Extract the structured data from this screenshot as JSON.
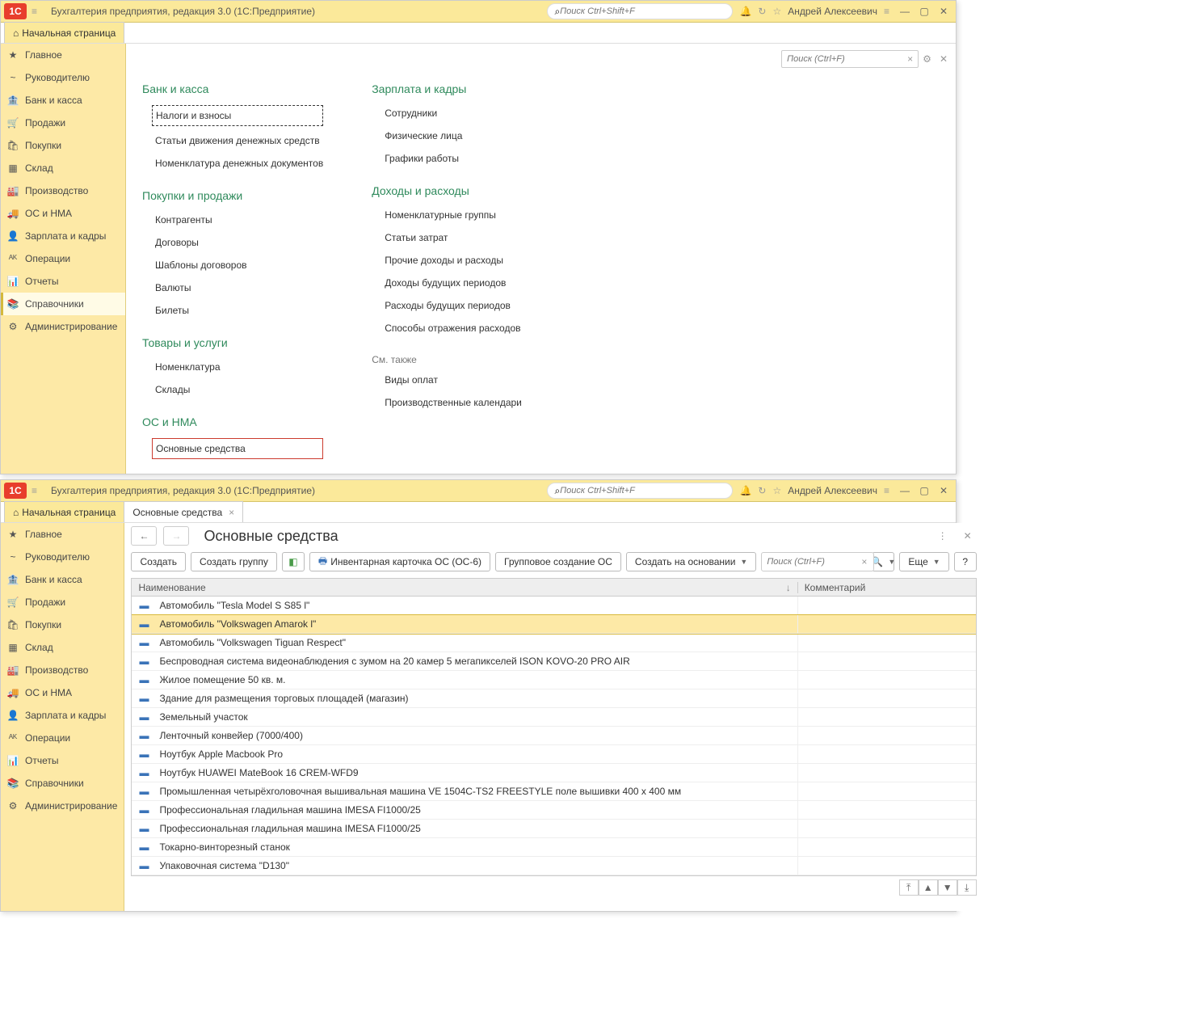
{
  "header": {
    "logo": "1C",
    "title": "Бухгалтерия предприятия, редакция 3.0  (1С:Предприятие)",
    "search_placeholder": "Поиск Ctrl+Shift+F",
    "user": "Андрей Алексеевич"
  },
  "tabs": {
    "home": "Начальная страница",
    "secondary": "Основные средства"
  },
  "sidebar_items": [
    {
      "label": "Главное"
    },
    {
      "label": "Руководителю"
    },
    {
      "label": "Банк и касса"
    },
    {
      "label": "Продажи"
    },
    {
      "label": "Покупки"
    },
    {
      "label": "Склад"
    },
    {
      "label": "Производство"
    },
    {
      "label": "ОС и НМА"
    },
    {
      "label": "Зарплата и кадры"
    },
    {
      "label": "Операции"
    },
    {
      "label": "Отчеты"
    },
    {
      "label": "Справочники"
    },
    {
      "label": "Администрирование"
    }
  ],
  "content_search_placeholder": "Поиск (Ctrl+F)",
  "sections": {
    "col1": [
      {
        "title": "Банк и касса",
        "items": [
          "Налоги и взносы",
          "Статьи движения денежных средств",
          "Номенклатура денежных документов"
        ]
      },
      {
        "title": "Покупки и продажи",
        "items": [
          "Контрагенты",
          "Договоры",
          "Шаблоны договоров",
          "Валюты",
          "Билеты"
        ]
      },
      {
        "title": "Товары и услуги",
        "items": [
          "Номенклатура",
          "Склады"
        ]
      },
      {
        "title": "ОС и НМА",
        "items": [
          "Основные средства"
        ]
      }
    ],
    "col2": [
      {
        "title": "Зарплата и кадры",
        "items": [
          "Сотрудники",
          "Физические лица",
          "Графики работы"
        ]
      },
      {
        "title": "Доходы и расходы",
        "items": [
          "Номенклатурные группы",
          "Статьи затрат",
          "Прочие доходы и расходы",
          "Доходы будущих периодов",
          "Расходы будущих периодов",
          "Способы отражения расходов"
        ]
      },
      {
        "title_plain": "См. также",
        "items": [
          "Виды оплат",
          "Производственные календари"
        ]
      }
    ]
  },
  "list": {
    "title": "Основные средства",
    "buttons": {
      "create": "Создать",
      "create_group": "Создать группу",
      "inventory_card": "Инвентарная карточка ОС (ОС-6)",
      "group_create": "Групповое создание ОС",
      "create_based": "Создать на основании",
      "more": "Еще",
      "help": "?"
    },
    "search_placeholder": "Поиск (Ctrl+F)",
    "columns": {
      "name": "Наименование",
      "comment": "Комментарий"
    },
    "rows": [
      "Автомобиль \"Tesla Model S S85 l\"",
      "Автомобиль \"Volkswagen Amarok l\"",
      "Автомобиль \"Volkswagen Tiguan Respect\"",
      "Беспроводная система видеонаблюдения с зумом на 20 камер 5 мегапикселей ISON KOVO-20 PRO AIR",
      "Жилое помещение 50 кв. м.",
      "Здание для размещения торговых площадей (магазин)",
      "Земельный участок",
      "Ленточный конвейер (7000/400)",
      "Ноутбук Apple Macbook Pro",
      "Ноутбук HUAWEI MateBook 16 CREM-WFD9",
      "Промышленная четырёхголовочная вышивальная машина VE 1504C-TS2 FREESTYLE поле вышивки 400 х 400 мм",
      "Профессиональная гладильная машина IMESA FI1000/25",
      "Профессиональная гладильная машина IMESA FI1000/25",
      "Токарно-винторезный станок",
      "Упаковочная система \"D130\""
    ],
    "selected_index": 1
  }
}
